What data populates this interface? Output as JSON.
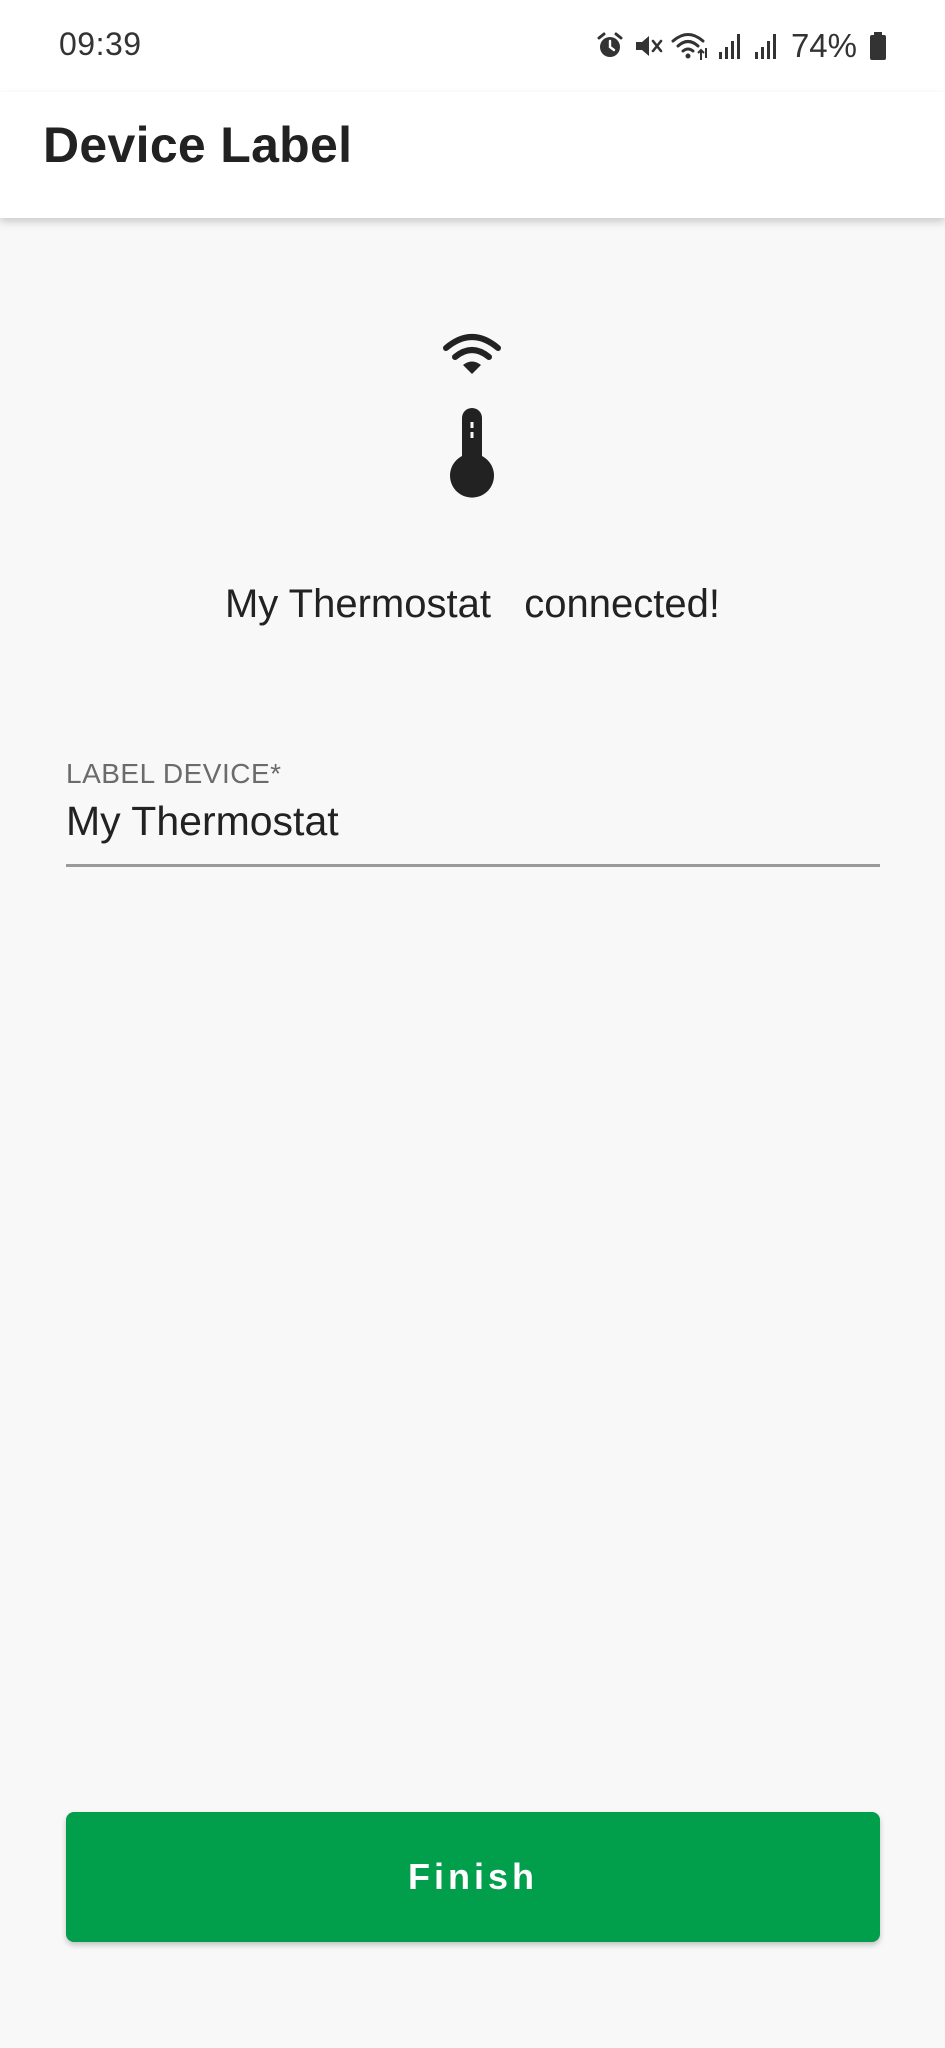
{
  "status_bar": {
    "time": "09:39",
    "battery_percent": "74%",
    "icons": [
      "alarm-icon",
      "mute-icon",
      "wifi-icon",
      "cell-signal-icon",
      "cell-signal-icon",
      "battery-icon"
    ]
  },
  "app_bar": {
    "title": "Device Label"
  },
  "content": {
    "connected_message": "My Thermostat   connected!",
    "label_field": {
      "label": "LABEL DEVICE*",
      "value": "My Thermostat"
    },
    "finish_label": "Finish"
  },
  "colors": {
    "accent": "#019e4c",
    "background": "#f8f8f8",
    "app_bar": "#ffffff",
    "text": "#222222",
    "label": "#6b6b6b"
  }
}
